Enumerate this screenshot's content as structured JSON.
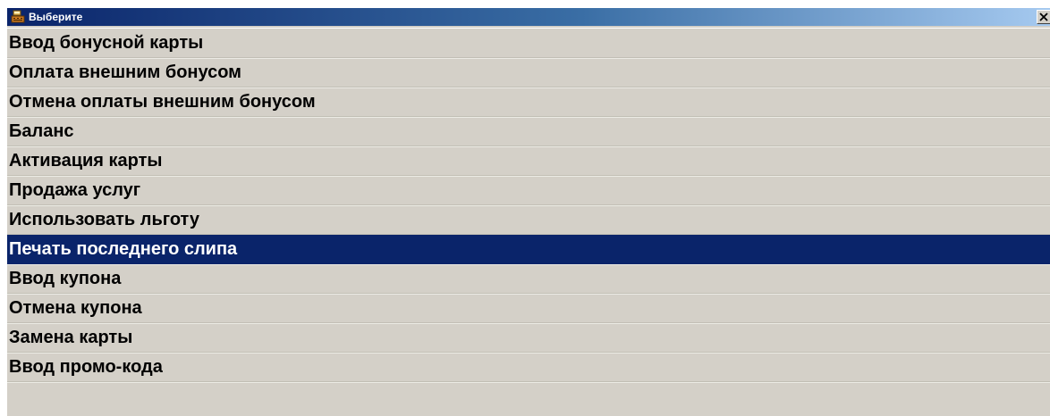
{
  "window": {
    "title": "Выберите",
    "icon": "register-icon",
    "close_label": "close-icon"
  },
  "menu": {
    "selected_index": 7,
    "items": [
      {
        "label": "Ввод бонусной карты"
      },
      {
        "label": "Оплата внешним бонусом"
      },
      {
        "label": "Отмена оплаты внешним бонусом"
      },
      {
        "label": "Баланс"
      },
      {
        "label": "Активация карты"
      },
      {
        "label": "Продажа услуг"
      },
      {
        "label": "Использовать льготу"
      },
      {
        "label": "Печать последнего слипа"
      },
      {
        "label": "Ввод купона"
      },
      {
        "label": "Отмена купона"
      },
      {
        "label": "Замена карты"
      },
      {
        "label": "Ввод промо-кода"
      }
    ]
  },
  "colors": {
    "title_bar_start": "#0a246a",
    "title_bar_end": "#a6caf0",
    "selection": "#0a246a",
    "window_bg": "#d4d0c8"
  }
}
